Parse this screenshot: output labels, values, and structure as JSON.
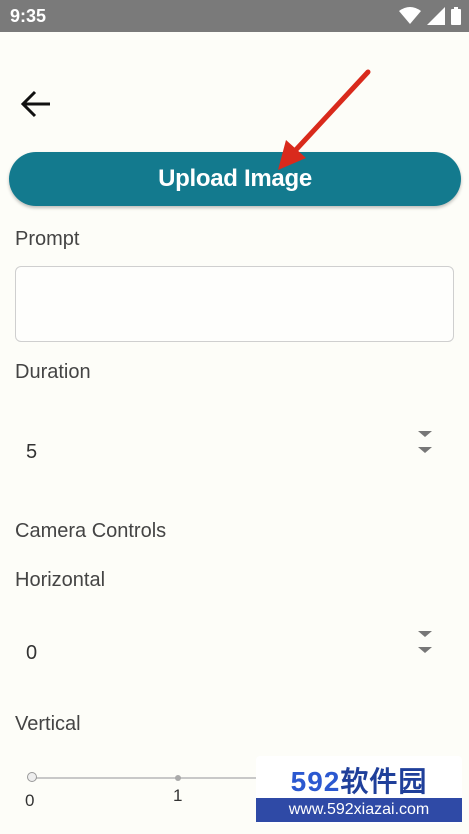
{
  "status_bar": {
    "time": "9:35",
    "icons": [
      "wifi-icon",
      "signal-icon",
      "battery-icon"
    ]
  },
  "header": {
    "back_icon": "back-arrow-icon"
  },
  "upload": {
    "label": "Upload Image",
    "color": "#137a8e"
  },
  "form": {
    "prompt_label": "Prompt",
    "prompt_value": "",
    "duration_label": "Duration",
    "duration_value": "5",
    "camera_controls_label": "Camera Controls",
    "horizontal_label": "Horizontal",
    "horizontal_value": "0",
    "vertical_label": "Vertical",
    "vertical_slider": {
      "min_label": "0",
      "mid_label": "1",
      "value": 0
    }
  },
  "watermark": {
    "title_num": "592",
    "title_text": "软件园",
    "url": "www.592xiazai.com"
  }
}
